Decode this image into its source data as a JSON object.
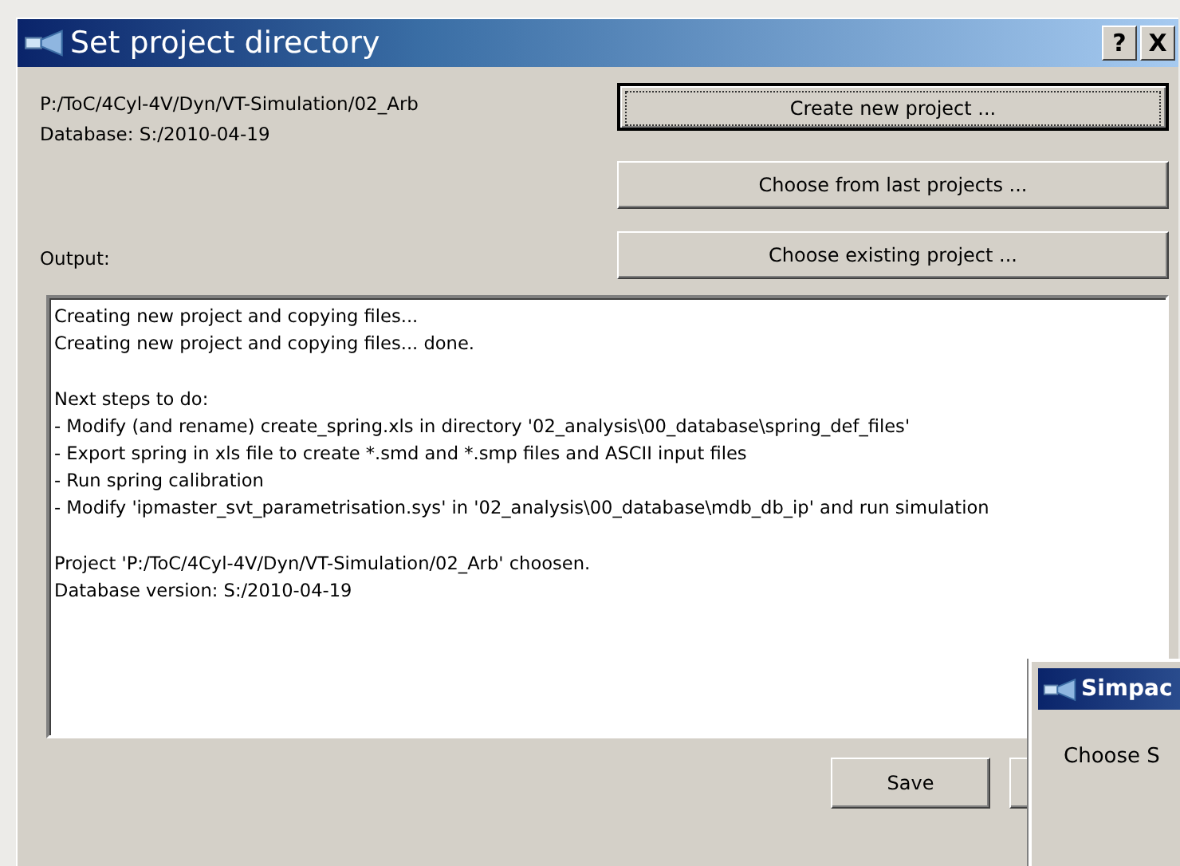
{
  "window": {
    "title": "Set project directory",
    "help": "?",
    "close": "X"
  },
  "project_path": "P:/ToC/4Cyl-4V/Dyn/VT-Simulation/02_Arb",
  "database": "Database: S:/2010-04-19",
  "output_label": "Output:",
  "buttons": [
    {
      "label": "Create new project ...",
      "focused": true
    },
    {
      "label": "Choose from last projects ...",
      "focused": false
    },
    {
      "label": "Choose existing project ...",
      "focused": false
    }
  ],
  "output_paragraphs": [
    [
      "Creating new project and copying files...",
      "Creating new project and copying files... done."
    ],
    [
      "Next steps to do:",
      "- Modify (and rename) create_spring.xls in directory '02_analysis\\00_database\\spring_def_files'",
      "- Export spring in xls file to create *.smd and *.smp files and ASCII input files",
      "- Run spring calibration",
      "- Modify 'ipmaster_svt_parametrisation.sys' in '02_analysis\\00_database\\mdb_db_ip' and run simulation"
    ],
    [
      "Project 'P:/ToC/4Cyl-4V/Dyn/VT-Simulation/02_Arb' choosen.",
      "Database version: S:/2010-04-19"
    ]
  ],
  "footer_buttons": [
    "Save"
  ],
  "popup": {
    "title": "Simpac",
    "text": "Choose S"
  }
}
